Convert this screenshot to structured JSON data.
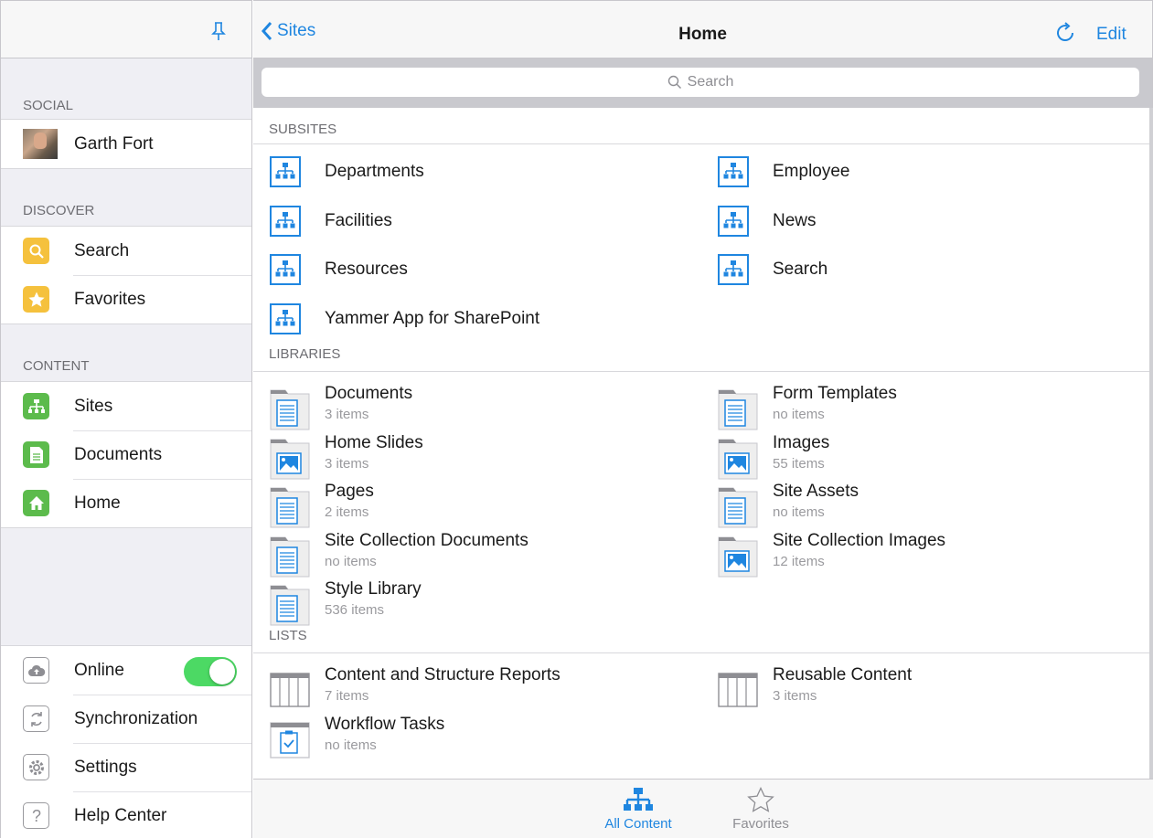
{
  "sidebar": {
    "sections": {
      "social": "SOCIAL",
      "discover": "DISCOVER",
      "content": "CONTENT"
    },
    "user": {
      "name": "Garth Fort"
    },
    "discover_items": [
      "Search",
      "Favorites"
    ],
    "content_items": [
      "Sites",
      "Documents",
      "Home"
    ],
    "bottom_items": [
      "Online",
      "Synchronization",
      "Settings",
      "Help Center"
    ],
    "online_toggle": true
  },
  "topbar": {
    "back_label": "Sites",
    "title": "Home",
    "edit_label": "Edit"
  },
  "search": {
    "placeholder": "Search"
  },
  "subsites": {
    "title": "SUBSITES",
    "items": [
      "Departments",
      "Employee",
      "Facilities",
      "News",
      "Resources",
      "Search",
      "Yammer App for SharePoint"
    ]
  },
  "libraries": {
    "title": "LIBRARIES",
    "items": [
      {
        "name": "Documents",
        "count": "3 items",
        "icon": "document-library-icon"
      },
      {
        "name": "Form Templates",
        "count": "no items",
        "icon": "document-library-icon"
      },
      {
        "name": "Home Slides",
        "count": "3 items",
        "icon": "picture-library-icon"
      },
      {
        "name": "Images",
        "count": "55 items",
        "icon": "picture-library-icon"
      },
      {
        "name": "Pages",
        "count": "2 items",
        "icon": "document-library-icon"
      },
      {
        "name": "Site Assets",
        "count": "no items",
        "icon": "document-library-icon"
      },
      {
        "name": "Site Collection Documents",
        "count": "no items",
        "icon": "document-library-icon"
      },
      {
        "name": "Site Collection Images",
        "count": "12 items",
        "icon": "picture-library-icon"
      },
      {
        "name": "Style Library",
        "count": "536 items",
        "icon": "document-library-icon"
      }
    ]
  },
  "lists": {
    "title": "LISTS",
    "items": [
      {
        "name": "Content and Structure Reports",
        "count": "7 items",
        "icon": "list-icon"
      },
      {
        "name": "Reusable Content",
        "count": "3 items",
        "icon": "list-icon"
      },
      {
        "name": "Workflow Tasks",
        "count": "no items",
        "icon": "task-list-icon"
      }
    ]
  },
  "tabbar": {
    "all_content": "All Content",
    "favorites": "Favorites"
  },
  "colors": {
    "accent": "#1f86e0",
    "toggle_on": "#4cd964",
    "discover_icon": "#f5c13d",
    "content_icon": "#5cbb4c"
  }
}
